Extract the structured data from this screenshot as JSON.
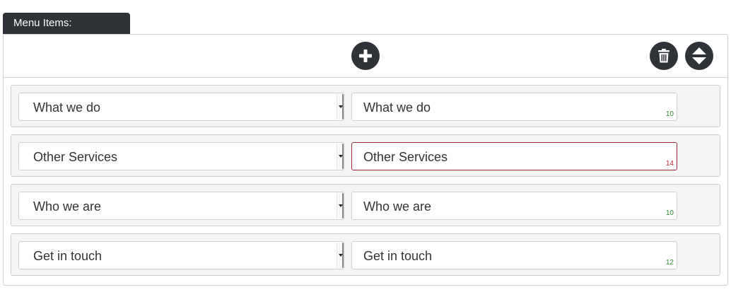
{
  "header": {
    "tab_label": "Menu Items:"
  },
  "toolbar": {
    "add_icon": "plus-icon",
    "delete_icon": "trash-icon",
    "sort_icon": "sort-icon"
  },
  "colors": {
    "button_bg": "#2f3338",
    "valid_count": "#2e8b2e",
    "invalid_count": "#b52a3a",
    "invalid_border": "#9c2a3c"
  },
  "menu_items": [
    {
      "select_value": "What we do",
      "label_value": "What we do",
      "char_count": "10",
      "valid": true
    },
    {
      "select_value": "Other Services",
      "label_value": "Other Services",
      "char_count": "14",
      "valid": false
    },
    {
      "select_value": "Who we are",
      "label_value": "Who we are",
      "char_count": "10",
      "valid": true
    },
    {
      "select_value": "Get in touch",
      "label_value": "Get in touch",
      "char_count": "12",
      "valid": true
    }
  ]
}
